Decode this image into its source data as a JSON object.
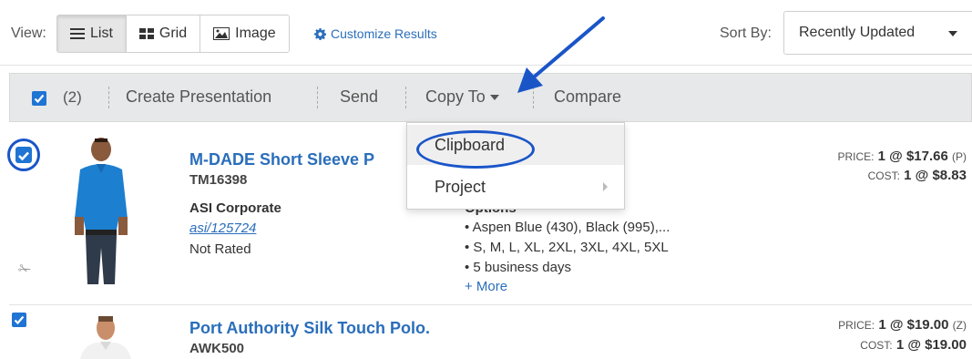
{
  "viewbar": {
    "view_label": "View:",
    "views": [
      {
        "label": "List",
        "icon": "list-icon",
        "active": true
      },
      {
        "label": "Grid",
        "icon": "grid-icon",
        "active": false
      },
      {
        "label": "Image",
        "icon": "image-icon",
        "active": false
      }
    ],
    "customize_label": "Customize Results",
    "sort_label": "Sort By:",
    "sort_value": "Recently Updated"
  },
  "actionbar": {
    "selected_count": "(2)",
    "create_presentation": "Create Presentation",
    "send": "Send",
    "copy_to": "Copy To",
    "compare": "Compare"
  },
  "menu": {
    "items": [
      {
        "label": "Clipboard"
      },
      {
        "label": "Project"
      }
    ]
  },
  "products": [
    {
      "title": "M-DADE Short Sleeve P",
      "sku": "TM16398",
      "supplier": "ASI Corporate",
      "supplier_id": "asi/125724",
      "rating": "Not Rated",
      "options_head": "Options",
      "options": [
        "• Aspen Blue (430), Black (995),...",
        "• S, M, L, XL, 2XL, 3XL, 4XL, 5XL",
        "• 5 business days"
      ],
      "more": "+ More",
      "price_label": "PRICE:",
      "price_value": "1 @ $17.66",
      "price_code": "(P)",
      "cost_label": "COST:",
      "cost_value": "1 @ $8.83"
    },
    {
      "title": "Port Authority Silk Touch Polo.",
      "sku": "AWK500",
      "price_label": "PRICE:",
      "price_value": "1 @ $19.00",
      "price_code": "(Z)",
      "cost_label": "COST:",
      "cost_value": "1 @ $19.00"
    }
  ],
  "colors": {
    "accent": "#2a6ebb",
    "annotation": "#1a55c8",
    "checkbox": "#1f74d4"
  }
}
